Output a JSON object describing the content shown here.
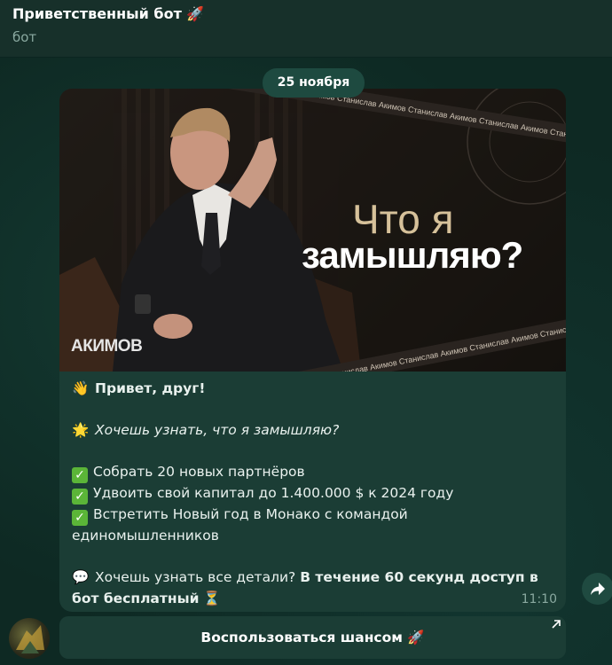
{
  "header": {
    "title": "Приветственный бот 🚀",
    "subtitle": "бот"
  },
  "chat": {
    "date_separator": "25 ноября"
  },
  "message": {
    "image": {
      "title_line1": "Что я",
      "title_line2": "замышляю?",
      "logo_text": "АКИМОВ",
      "ribbon_text": "Станислав Акимов",
      "icon": "photo-media"
    },
    "greeting": "Привет, друг!",
    "greeting_emoji": "👋",
    "question_emoji": "🌟",
    "question": "Хочешь узнать, что я замышляю?",
    "goals": [
      "Собрать 20 новых партнёров",
      "Удвоить свой капитал до 1.400.000 $ к 2024 году",
      "Встретить Новый год в Монако с командой единомышленников"
    ],
    "check_icon": "✓",
    "detail_emoji": "💬",
    "detail_plain": "Хочешь узнать все детали? ",
    "detail_bold": "В течение 60 секунд доступ в бот бесплатный",
    "detail_end_emoji": "⏳",
    "time": "11:10"
  },
  "inline_keyboard": {
    "button_label": "Воспользоваться шансом 🚀",
    "button_icon": "external-arrow-icon"
  },
  "colors": {
    "header_bg": "#17302a",
    "chat_bg": "#0e2923",
    "bubble_bg": "#1b3d35",
    "accent_green": "#5bb538",
    "gold_text": "#d6c19a"
  }
}
